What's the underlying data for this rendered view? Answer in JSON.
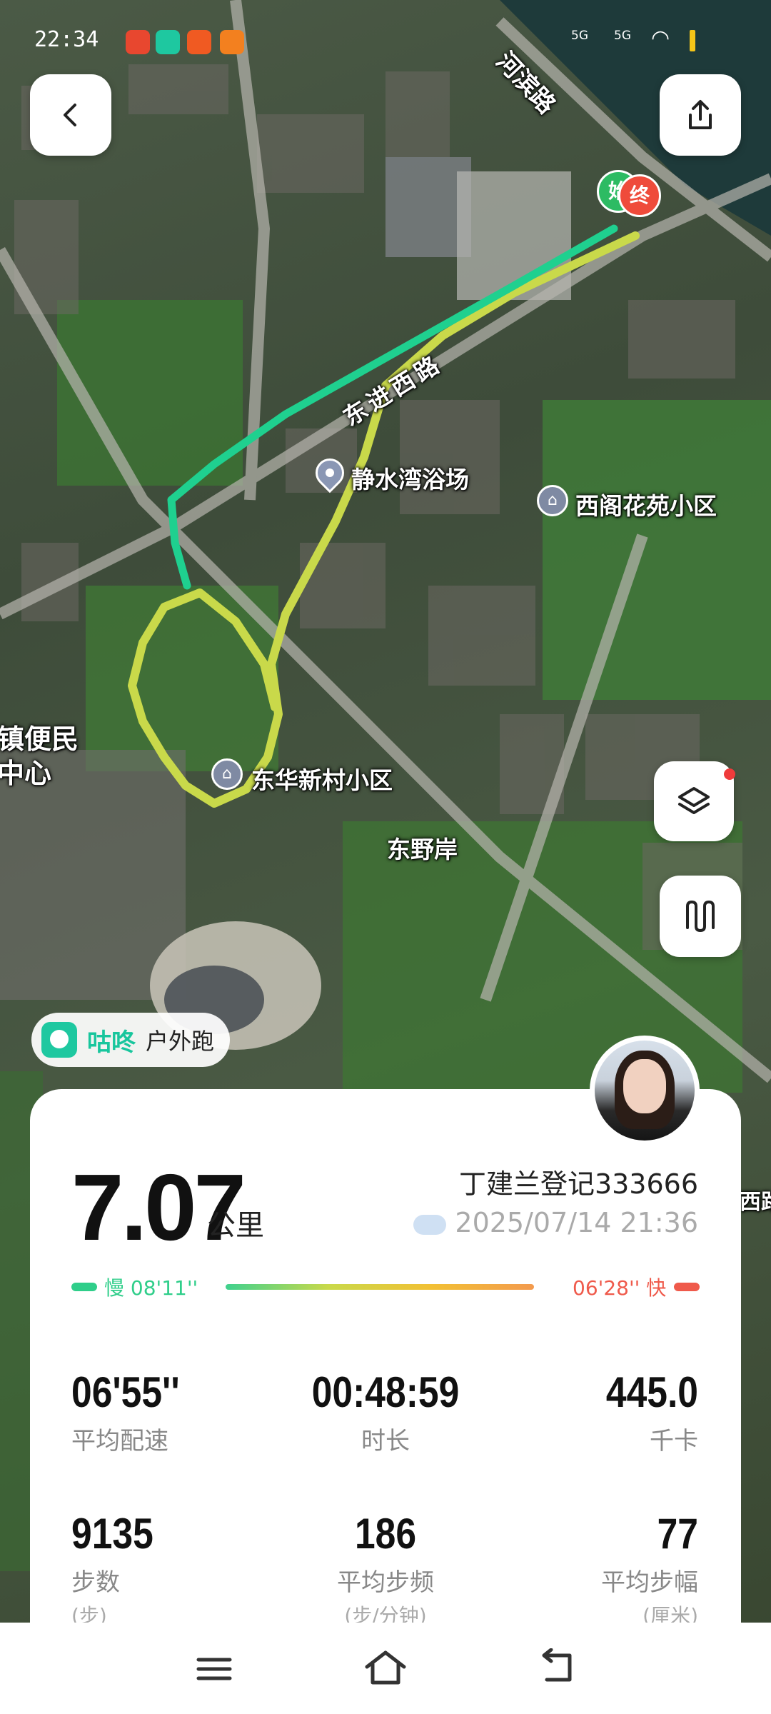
{
  "status_bar": {
    "time": "22:34",
    "network_1": "5G",
    "network_2": "5G"
  },
  "map": {
    "labels": {
      "road_hebin": "河滨路",
      "road_dongjin": "东进西路",
      "poi_bath": "静水湾浴场",
      "poi_xige": "西阁花苑小区",
      "poi_donghua": "东华新村小区",
      "area_dongye": "东野岸",
      "area_left_1": "镇便民",
      "area_left_2": "中心",
      "edge_fragment": "西路"
    },
    "markers": {
      "start": "始",
      "end": "终"
    },
    "route_colors": {
      "start_segment": "#1fd08f",
      "slow_segment": "#c9d94a"
    }
  },
  "app_badge": {
    "brand": "咕咚",
    "activity": "户外跑",
    "brand_color": "#18c69d"
  },
  "summary": {
    "distance": "7.07",
    "distance_unit": "公里",
    "user": "丁建兰登记333666",
    "datetime": "2025/07/14 21:36",
    "weather_icon": "cloud-icon",
    "pace_slow_label": "慢 08'11''",
    "pace_fast_label": "06'28'' 快"
  },
  "stats": {
    "row1": [
      {
        "value": "06'55''",
        "label": "平均配速"
      },
      {
        "value": "00:48:59",
        "label": "时长"
      },
      {
        "value": "445.0",
        "label": "千卡"
      }
    ],
    "row2": [
      {
        "value": "9135",
        "label": "步数",
        "unit": "(步)"
      },
      {
        "value": "186",
        "label": "平均步频",
        "unit": "(步/分钟)"
      },
      {
        "value": "77",
        "label": "平均步幅",
        "unit": "(厘米)"
      }
    ]
  },
  "accent_colors": {
    "slow": "#2fce8a",
    "fast": "#ef5a4b",
    "end_marker": "#ef4b3b",
    "start_marker": "#2dbb63"
  }
}
